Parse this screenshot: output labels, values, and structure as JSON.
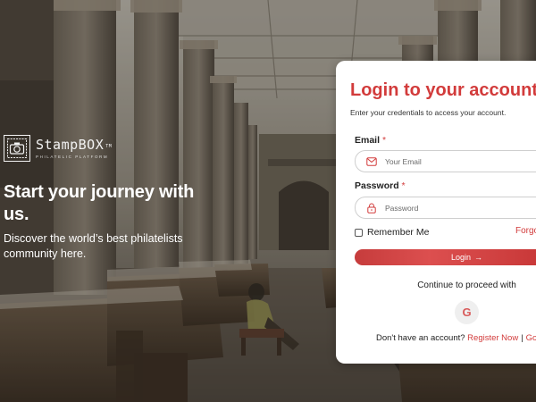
{
  "brand": {
    "name": "StampBOX",
    "trademark": "TM",
    "tagline": "PHILATELIC PLATFORM",
    "logo_icon": "stamp-camera-icon"
  },
  "hero": {
    "title": "Start your journey with us.",
    "subtitle": "Discover the world’s best philatelists community here."
  },
  "login": {
    "title": "Login to your account",
    "subtitle": "Enter your credentials to access your account.",
    "email_label": "Email",
    "password_label": "Password",
    "required_mark": "*",
    "email_placeholder": "Your Email",
    "email_value": "",
    "password_placeholder": "Password",
    "password_value": "",
    "email_icon": "mail-icon",
    "password_icon": "lock-icon",
    "remember_label": "Remember Me",
    "remember_checked": false,
    "forgot_label": "Forgot",
    "button_label": "Login",
    "button_icon": "arrow-right-icon",
    "continue_text": "Continue to proceed with",
    "google_label": "G",
    "footer_prefix": "Don't have an account?",
    "register_link": "Register Now",
    "separator": "|",
    "goto_link": "Go to"
  },
  "colors": {
    "accent": "#d23b3b",
    "card_bg": "#ffffff",
    "text": "#222222",
    "google_bg": "#efefef"
  }
}
